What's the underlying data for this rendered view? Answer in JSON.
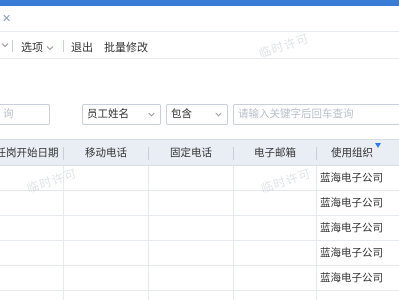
{
  "titlebar": {
    "close_glyph": "✕"
  },
  "toolbar": {
    "options_label": "选项",
    "exit_label": "退出",
    "batch_edit_label": "批量修改"
  },
  "filters": {
    "first_placeholder": "询",
    "field_select": "员工姓名",
    "operator_select": "包含",
    "keyword_placeholder": "请输入关键字后回车查询"
  },
  "table": {
    "columns": [
      "任岗开始日期",
      "移动电话",
      "固定电话",
      "电子邮箱",
      "使用组织"
    ],
    "rows": [
      {
        "org": "蓝海电子公司"
      },
      {
        "org": "蓝海电子公司"
      },
      {
        "org": "蓝海电子公司"
      },
      {
        "org": "蓝海电子公司"
      },
      {
        "org": "蓝海电子公司"
      }
    ]
  },
  "watermark": "临时许可",
  "colors": {
    "accent": "#3a7bd5",
    "header_bg": "#e9eef5",
    "filter_icon": "#2f7ae5"
  }
}
